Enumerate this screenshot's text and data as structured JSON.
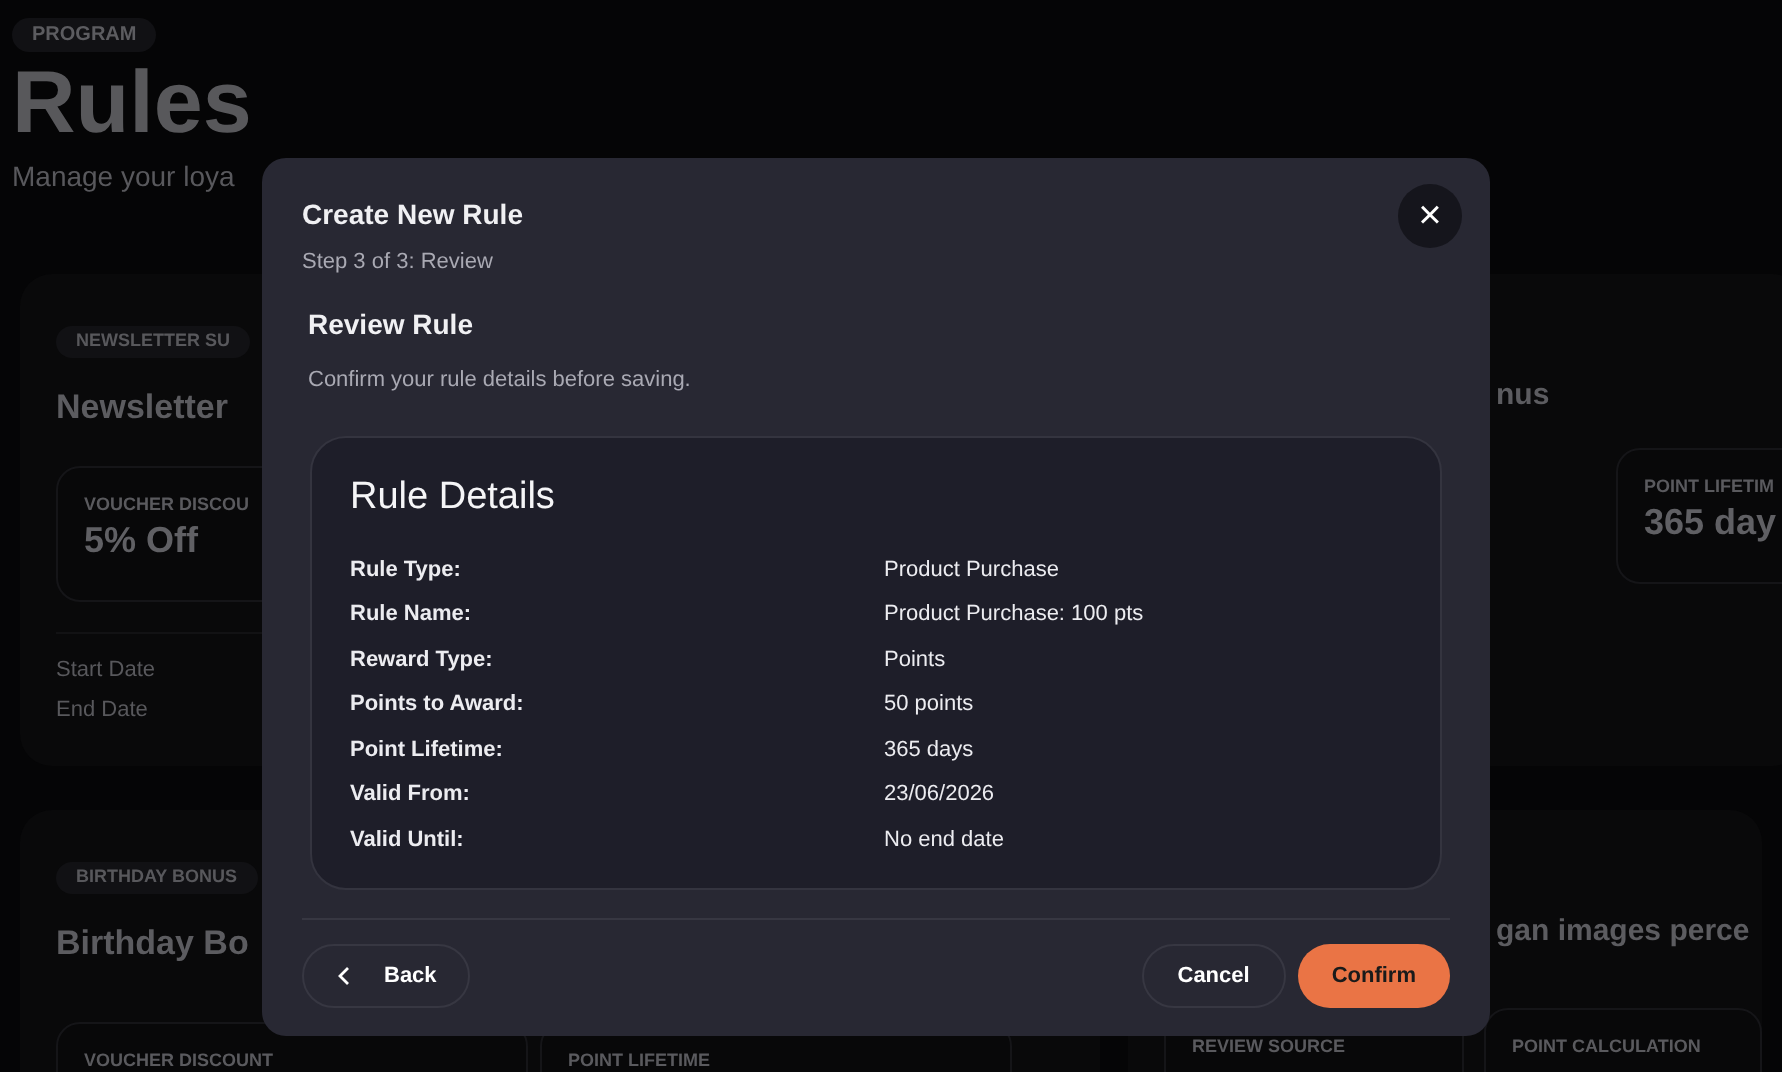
{
  "page": {
    "badge": "PROGRAM",
    "title": "Rules",
    "subtitle": "Manage your loya"
  },
  "cards": [
    {
      "tag": "NEWSLETTER SU",
      "title": "Newsletter",
      "stats": [
        {
          "label": "VOUCHER DISCOU",
          "value": "5% Off"
        }
      ],
      "dates": [
        "Start Date",
        "End Date"
      ],
      "right": {
        "title": "nus",
        "stats": [
          {
            "label": "POINT LIFETIM",
            "value": "365 day"
          }
        ]
      }
    },
    {
      "tag": "BIRTHDAY BONUS",
      "title": "Birthday Bo",
      "stats": [
        {
          "label": "VOUCHER DISCOUNT"
        },
        {
          "label": "POINT LIFETIME"
        }
      ],
      "right": {
        "title": "gan images perce",
        "stats": [
          {
            "label": "REVIEW SOURCE"
          },
          {
            "label": "POINT CALCULATION"
          }
        ]
      }
    }
  ],
  "modal": {
    "title": "Create New Rule",
    "step": "Step 3 of 3: Review",
    "close": "×",
    "section_title": "Review Rule",
    "section_desc": "Confirm your rule details before saving.",
    "details_title": "Rule Details",
    "details": [
      {
        "label": "Rule Type:",
        "value": "Product Purchase"
      },
      {
        "label": "Rule Name:",
        "value": "Product Purchase: 100 pts"
      },
      {
        "label": "Reward Type:",
        "value": "Points"
      },
      {
        "label": "Points to Award:",
        "value": "50 points"
      },
      {
        "label": "Point Lifetime:",
        "value": "365 days"
      },
      {
        "label": "Valid From:",
        "value": "23/06/2026"
      },
      {
        "label": "Valid Until:",
        "value": "No end date"
      }
    ],
    "back": "Back",
    "cancel": "Cancel",
    "confirm": "Confirm"
  }
}
